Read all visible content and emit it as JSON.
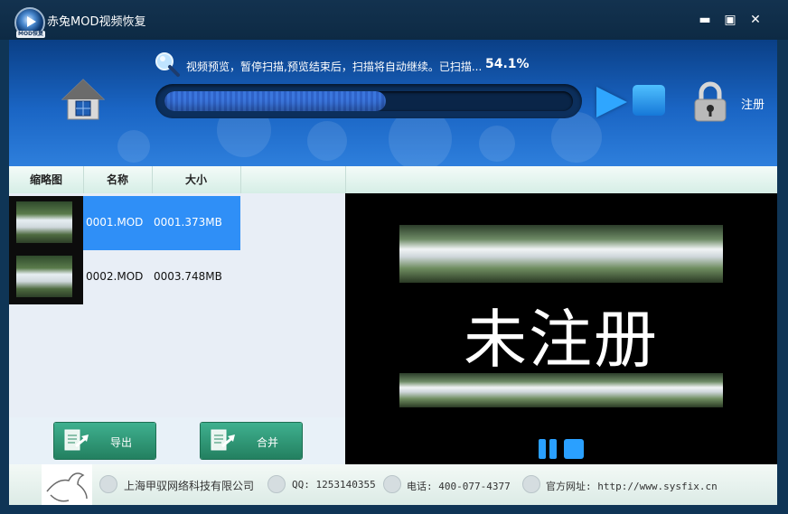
{
  "window": {
    "title": "赤兔MOD视频恢复",
    "logo_tag": "MOD恢复",
    "minimize": "▬",
    "maximize": "▣",
    "close": "✕"
  },
  "header": {
    "status_text": "视频预览，暂停扫描,预览结束后，扫描将自动继续。已扫描...",
    "progress_label": "54.1%",
    "progress_value": 0.541,
    "register_label": "注册"
  },
  "table": {
    "columns": [
      "缩略图",
      "名称",
      "大小"
    ],
    "rows": [
      {
        "name": "0001.MOD",
        "size": "0001.373MB",
        "selected": true
      },
      {
        "name": "0002.MOD",
        "size": "0003.748MB",
        "selected": false
      }
    ]
  },
  "actions": {
    "export_label": "导出",
    "merge_label": "合并"
  },
  "preview": {
    "watermark": "未注册"
  },
  "footer": {
    "company": "上海甲驭网络科技有限公司",
    "qq": "QQ: 1253140355",
    "phone": "电话: 400-077-4377",
    "website": "官方网址: http://www.sysfix.cn"
  },
  "colors": {
    "banner": "#1a65c4",
    "selected_row": "#2f8ff7",
    "button_green": "#2f9a76",
    "accent_blue": "#2aa0ff"
  }
}
